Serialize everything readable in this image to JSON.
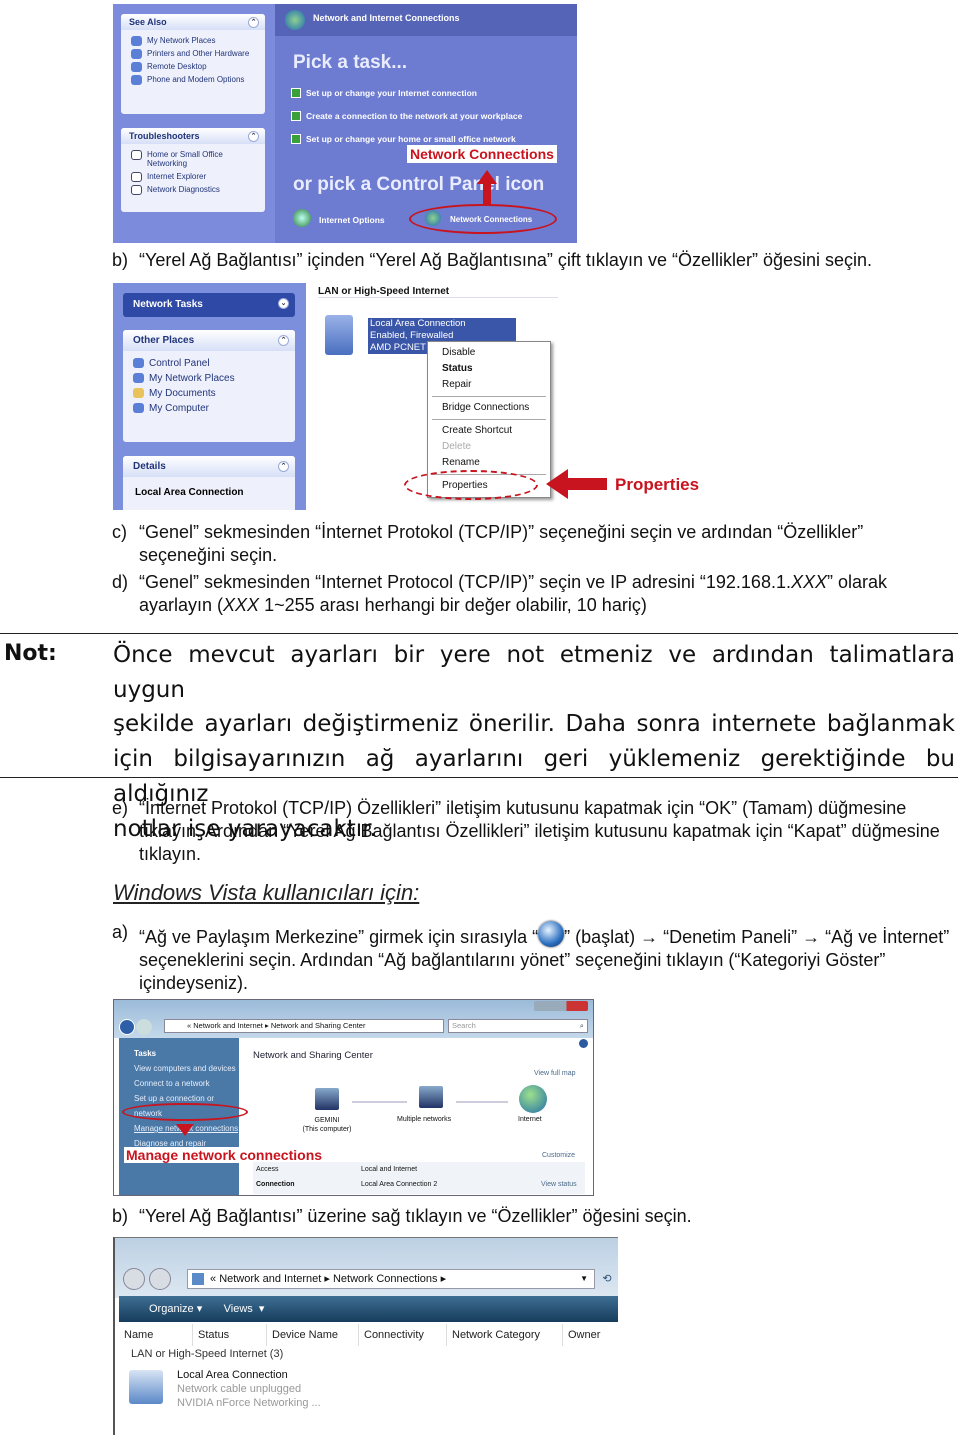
{
  "xp_control_panel": {
    "see_also": {
      "title": "See Also",
      "items": [
        "My Network Places",
        "Printers and Other Hardware",
        "Remote Desktop",
        "Phone and Modem Options"
      ]
    },
    "troubleshooters": {
      "title": "Troubleshooters",
      "items": [
        "Home or Small Office Networking",
        "Internet Explorer",
        "Network Diagnostics"
      ]
    },
    "header": "Network and Internet Connections",
    "pick_task": "Pick a task...",
    "tasks": [
      "Set up or change your Internet connection",
      "Create a connection to the network at your workplace",
      "Set up or change your home or small office network"
    ],
    "pick_icon": "or pick a Control Panel icon",
    "icons": [
      "Internet Options",
      "Network Connections"
    ],
    "callout": "Network Connections"
  },
  "step_xp_b": {
    "label": "b)",
    "text": "“Yerel Ağ Bağlantısı” içinden “Yerel Ağ Bağlantısına” çift tıklayın ve “Özellikler” öğesini seçin."
  },
  "xp_network_connections": {
    "network_tasks": "Network Tasks",
    "other_places": {
      "title": "Other Places",
      "items": [
        "Control Panel",
        "My Network Places",
        "My Documents",
        "My Computer"
      ]
    },
    "details": {
      "title": "Details",
      "value": "Local Area Connection"
    },
    "group": "LAN or High-Speed Internet",
    "connection": [
      "Local Area Connection",
      "Enabled, Firewalled",
      "AMD PCNET"
    ],
    "menu": [
      "Disable",
      "Status",
      "Repair",
      "Bridge Connections",
      "Create Shortcut",
      "Delete",
      "Rename",
      "Properties"
    ],
    "callout": "Properties"
  },
  "step_c": {
    "label": "c)",
    "text": "“Genel” sekmesinden “İnternet Protokol (TCP/IP)” seçeneğini seçin ve ardından “Özellikler” seçeneğini seçin."
  },
  "step_d": {
    "label": "d)",
    "text_before": "“Genel” sekmesinden “Internet Protocol (TCP/IP)” seçin ve IP adresini “192.168.1.",
    "xxx": "XXX",
    "text_mid": "” olarak ayarlayın (",
    "xxx2": "XXX",
    "text_after": " 1~255 arası herhangi bir değer olabilir, 10 hariç)"
  },
  "note": {
    "label": "Not:",
    "lines": [
      "Önce mevcut ayarları bir yere not etmeniz ve ardından talimatlara uygun",
      "şekilde ayarları değiştirmeniz önerilir. Daha sonra internete bağlanmak",
      "için bilgisayarınızın ağ ayarlarını geri yüklemeniz gerektiğinde bu aldığınız",
      "notlar işe yarayacaktır."
    ]
  },
  "step_e": {
    "label": "e)",
    "text": "“İnternet Protokol (TCP/IP) Özellikleri” iletişim kutusunu kapatmak için “OK” (Tamam) düğmesine tıklayın. Ardından “Yerel Ağ Bağlantısı Özellikleri” iletişim kutusunu kapatmak için “Kapat” düğmesine tıklayın."
  },
  "vista_heading": "Windows Vista kullanıcıları için:",
  "step_vista_a": {
    "label": "a)",
    "text_before": "“Ağ ve Paylaşım Merkezine” girmek için sırasıyla “",
    "text_after": "” (başlat) → “Denetim Paneli” → “Ağ ve İnternet” seçeneklerini seçin. Ardından “Ağ bağlantılarını yönet” seçeneğini tıklayın (“Kategoriyi Göster” içindeyseniz)."
  },
  "vista_sharing": {
    "breadcrumb": [
      "Network and Internet",
      "Network and Sharing Center"
    ],
    "search_placeholder": "Search",
    "tasks_title": "Tasks",
    "tasks": [
      "View computers and devices",
      "Connect to a network",
      "Set up a connection or network",
      "Manage network connections",
      "Diagnose and repair"
    ],
    "title": "Network and Sharing Center",
    "view_full_map": "View full map",
    "nodes": [
      "GEMINI",
      "(This computer)",
      "Multiple networks",
      "Internet"
    ],
    "customize": "Customize",
    "rows": [
      {
        "k": "Access",
        "v": "Local and Internet"
      },
      {
        "k": "Connection",
        "v": "Local Area Connection 2",
        "link": "View status"
      }
    ],
    "callout": "Manage network connections"
  },
  "step_vista_b": {
    "label": "b)",
    "text": "“Yerel Ağ Bağlantısı” üzerine sağ tıklayın ve “Özellikler” öğesini seçin."
  },
  "vista_connections": {
    "breadcrumb": [
      "Network and Internet",
      "Network Connections"
    ],
    "toolbar": [
      "Organize",
      "Views"
    ],
    "columns": [
      "Name",
      "Status",
      "Device Name",
      "Connectivity",
      "Network Category",
      "Owner"
    ],
    "group": "LAN or High-Speed Internet (3)",
    "item": [
      "Local Area Connection",
      "Network cable unplugged",
      "NVIDIA nForce Networking ..."
    ]
  },
  "colors": {
    "callout_red": "#c8141e",
    "xp_blue": "#6b78c8",
    "vista_sidebar": "#3b6d9b"
  }
}
